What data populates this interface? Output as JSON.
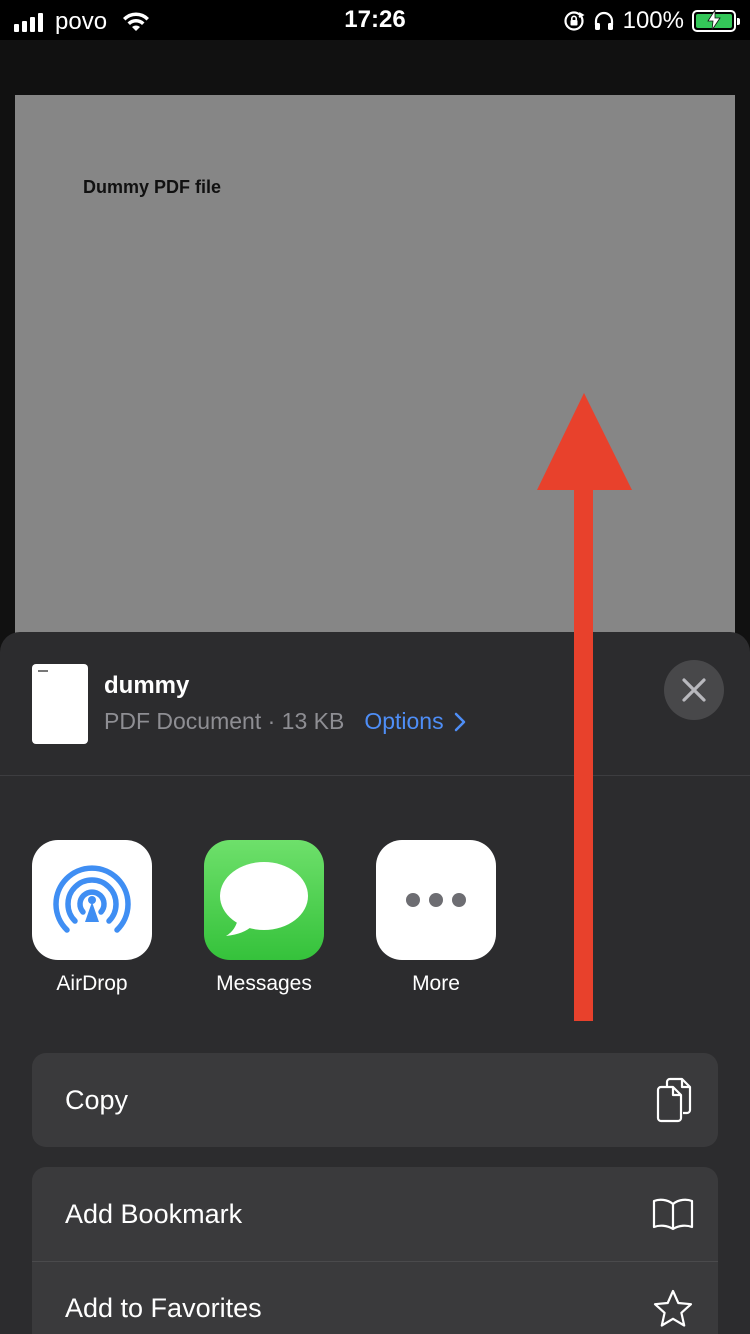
{
  "status_bar": {
    "carrier": "povo",
    "time": "17:26",
    "battery_percent": "100%",
    "battery_level": 1.0,
    "battery_color": "#34c759"
  },
  "document": {
    "title": "Dummy PDF file"
  },
  "share_sheet": {
    "file_name": "dummy",
    "file_meta": "PDF Document · 13 KB",
    "options_label": "Options",
    "accent_color": "#4e8ef7",
    "apps": [
      {
        "label": "AirDrop",
        "icon": "airdrop-icon"
      },
      {
        "label": "Messages",
        "icon": "messages-icon"
      },
      {
        "label": "More",
        "icon": "more-icon"
      }
    ],
    "actions": [
      {
        "label": "Copy",
        "icon": "copy-icon"
      },
      {
        "label": "Add Bookmark",
        "icon": "book-icon"
      },
      {
        "label": "Add to Favorites",
        "icon": "star-icon"
      }
    ]
  },
  "annotation": {
    "arrow_color": "#e8412c"
  }
}
